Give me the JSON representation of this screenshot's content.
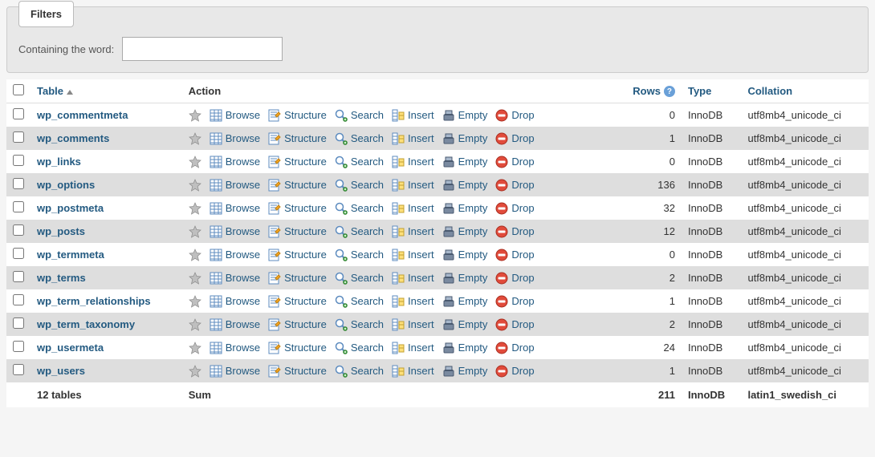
{
  "filters": {
    "tab_label": "Filters",
    "containing_label": "Containing the word:",
    "containing_value": ""
  },
  "columns": {
    "table": "Table",
    "action": "Action",
    "rows": "Rows",
    "type": "Type",
    "collation": "Collation"
  },
  "action_labels": {
    "browse": "Browse",
    "structure": "Structure",
    "search": "Search",
    "insert": "Insert",
    "empty": "Empty",
    "drop": "Drop"
  },
  "tables": [
    {
      "name": "wp_commentmeta",
      "rows": 0,
      "type": "InnoDB",
      "collation": "utf8mb4_unicode_ci"
    },
    {
      "name": "wp_comments",
      "rows": 1,
      "type": "InnoDB",
      "collation": "utf8mb4_unicode_ci"
    },
    {
      "name": "wp_links",
      "rows": 0,
      "type": "InnoDB",
      "collation": "utf8mb4_unicode_ci"
    },
    {
      "name": "wp_options",
      "rows": 136,
      "type": "InnoDB",
      "collation": "utf8mb4_unicode_ci"
    },
    {
      "name": "wp_postmeta",
      "rows": 32,
      "type": "InnoDB",
      "collation": "utf8mb4_unicode_ci"
    },
    {
      "name": "wp_posts",
      "rows": 12,
      "type": "InnoDB",
      "collation": "utf8mb4_unicode_ci"
    },
    {
      "name": "wp_termmeta",
      "rows": 0,
      "type": "InnoDB",
      "collation": "utf8mb4_unicode_ci"
    },
    {
      "name": "wp_terms",
      "rows": 2,
      "type": "InnoDB",
      "collation": "utf8mb4_unicode_ci"
    },
    {
      "name": "wp_term_relationships",
      "rows": 1,
      "type": "InnoDB",
      "collation": "utf8mb4_unicode_ci"
    },
    {
      "name": "wp_term_taxonomy",
      "rows": 2,
      "type": "InnoDB",
      "collation": "utf8mb4_unicode_ci"
    },
    {
      "name": "wp_usermeta",
      "rows": 24,
      "type": "InnoDB",
      "collation": "utf8mb4_unicode_ci"
    },
    {
      "name": "wp_users",
      "rows": 1,
      "type": "InnoDB",
      "collation": "utf8mb4_unicode_ci"
    }
  ],
  "summary": {
    "count_label": "12 tables",
    "sum_label": "Sum",
    "rows_total": 211,
    "type": "InnoDB",
    "collation": "latin1_swedish_ci"
  }
}
